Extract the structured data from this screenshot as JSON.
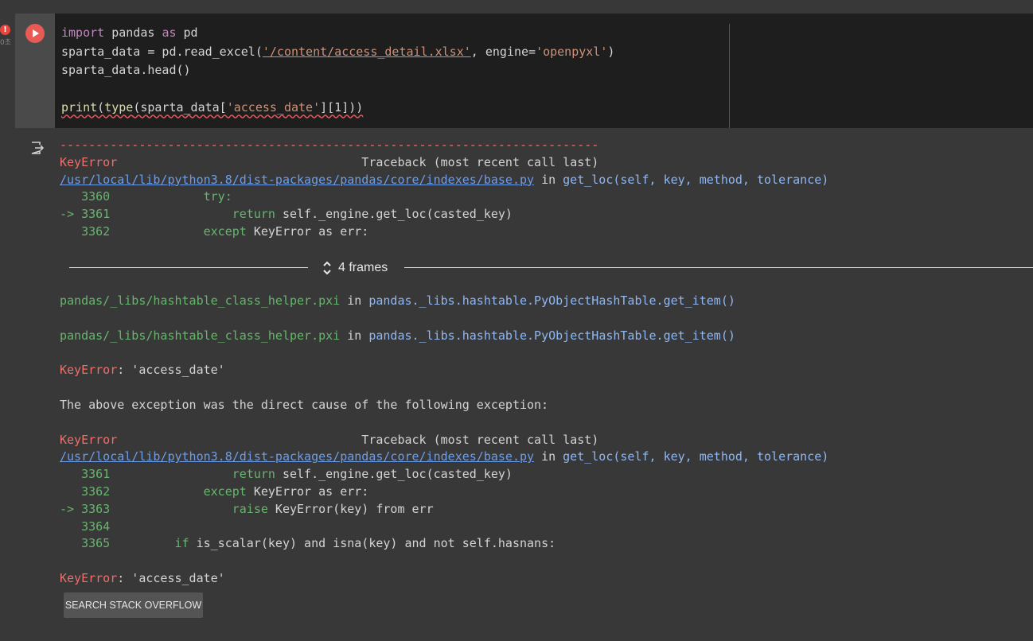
{
  "cell": {
    "error_badge": "!",
    "error_sub": "0초",
    "code_lines": [
      [
        "import",
        " pandas ",
        "as",
        " pd"
      ],
      [
        "sparta_data = pd.read_excel(",
        "'/content/access_detail.xlsx'",
        ", engine=",
        "'openpyxl'",
        ")"
      ],
      [
        "sparta_data.head()"
      ],
      [
        ""
      ],
      [
        "print",
        "(",
        "type",
        "(sparta_data[",
        "'access_date'",
        "][1]))"
      ]
    ]
  },
  "traceback": {
    "separator": "---------------------------------------------------------------------------",
    "header1": {
      "err": "KeyError",
      "title": "Traceback (most recent call last)"
    },
    "path": "/usr/local/lib/python3.8/dist-packages/pandas/core/indexes/base.py",
    "in_word": "in",
    "func1": "get_loc(self, key, method, tolerance)",
    "block1": [
      {
        "marker": "   ",
        "no": "3360",
        "indent": "             ",
        "kw": "try:",
        "rest": ""
      },
      {
        "marker": "-> ",
        "no": "3361",
        "indent": "                 ",
        "kw": "return",
        "rest": " self._engine.get_loc(casted_key)"
      },
      {
        "marker": "   ",
        "no": "3362",
        "indent": "             ",
        "kw": "except",
        "rest": " KeyError as err:"
      }
    ],
    "frames_label": "4 frames",
    "pxi_file": "pandas/_libs/hashtable_class_helper.pxi",
    "pxi_func": "pandas._libs.hashtable.PyObjectHashTable.get_item()",
    "keyerror_line": ": 'access_date'",
    "cause_text": "The above exception was the direct cause of the following exception:",
    "block2": [
      {
        "marker": "   ",
        "no": "3361",
        "indent": "                 ",
        "kw": "return",
        "rest": " self._engine.get_loc(casted_key)"
      },
      {
        "marker": "   ",
        "no": "3362",
        "indent": "             ",
        "kw": "except",
        "rest": " KeyError as err:"
      },
      {
        "marker": "-> ",
        "no": "3363",
        "indent": "                 ",
        "kw": "raise",
        "rest": " KeyError(key) from err"
      },
      {
        "marker": "   ",
        "no": "3364",
        "indent": "",
        "kw": "",
        "rest": ""
      },
      {
        "marker": "   ",
        "no": "3365",
        "indent": "         ",
        "kw": "if",
        "rest": " is_scalar(key) and isna(key) and not self.hasnans:"
      }
    ]
  },
  "button": {
    "label": "SEARCH STACK OVERFLOW"
  }
}
